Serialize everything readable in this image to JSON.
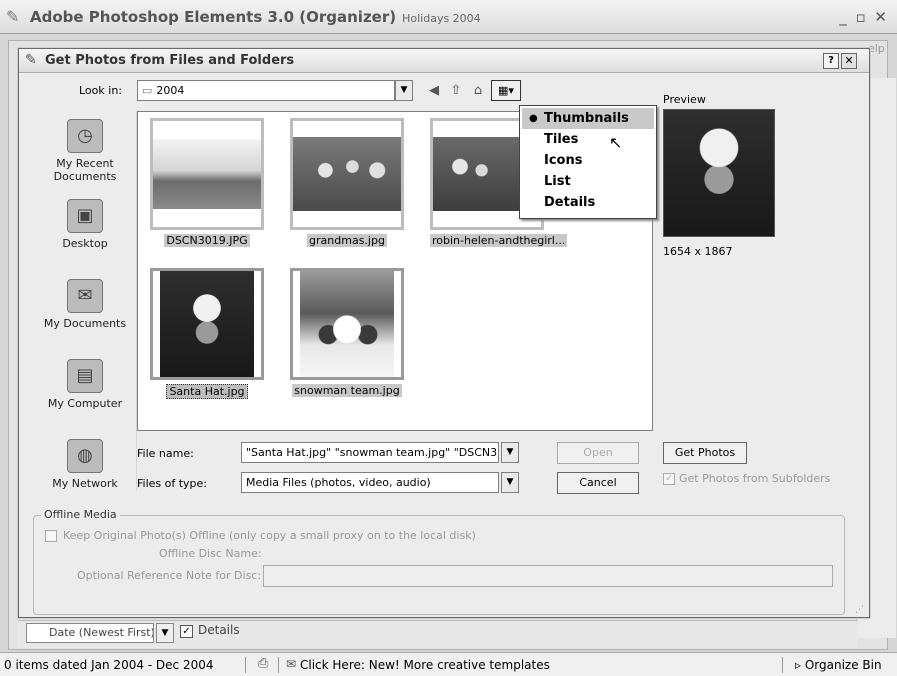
{
  "app": {
    "title": "Adobe Photoshop Elements 3.0 (Organizer)",
    "subtitle": "Holidays 2004",
    "window_controls": "_ ▫ ✕",
    "help_hint": "elp"
  },
  "dialog": {
    "title": "Get Photos from Files and Folders",
    "help_btn": "?",
    "close_btn": "✕",
    "look_in_label": "Look in:",
    "look_in_value": "2004",
    "places": [
      {
        "label": "My Recent Documents",
        "icon": "recent-documents-icon"
      },
      {
        "label": "Desktop",
        "icon": "desktop-icon"
      },
      {
        "label": "My Documents",
        "icon": "my-documents-icon"
      },
      {
        "label": "My Computer",
        "icon": "my-computer-icon"
      },
      {
        "label": "My Network",
        "icon": "my-network-icon"
      }
    ],
    "files": [
      {
        "name": "DSCN3019.JPG"
      },
      {
        "name": "grandmas.jpg"
      },
      {
        "name": "robin-helen-andthegirl..."
      },
      {
        "name": "Santa Hat.jpg"
      },
      {
        "name": "snowman team.jpg"
      }
    ],
    "views_menu": {
      "items": [
        "Thumbnails",
        "Tiles",
        "Icons",
        "List",
        "Details"
      ],
      "selected": "Thumbnails"
    },
    "preview_label": "Preview",
    "preview_dims": "1654 x 1867",
    "file_name_label": "File name:",
    "file_name_value": "\"Santa Hat.jpg\" \"snowman team.jpg\" \"DSCN3",
    "file_type_label": "Files of type:",
    "file_type_value": "Media Files (photos, video, audio)",
    "open_btn": "Open",
    "cancel_btn": "Cancel",
    "get_photos_btn": "Get Photos",
    "subfolders_label": "Get Photos from Subfolders",
    "offline": {
      "legend": "Offline Media",
      "keep_label": "Keep Original Photo(s) Offline (only copy a small proxy on to the local disk)",
      "disc_name_label": "Offline Disc Name:",
      "ref_note_label": "Optional Reference Note for Disc:"
    }
  },
  "organizer": {
    "sort_value": "Date (Newest First)",
    "details_label": "Details",
    "status_text": "0 items dated Jan 2004 - Dec 2004",
    "promo": "Click Here: New! More creative templates",
    "organize_bin": "▹ Organize Bin"
  }
}
